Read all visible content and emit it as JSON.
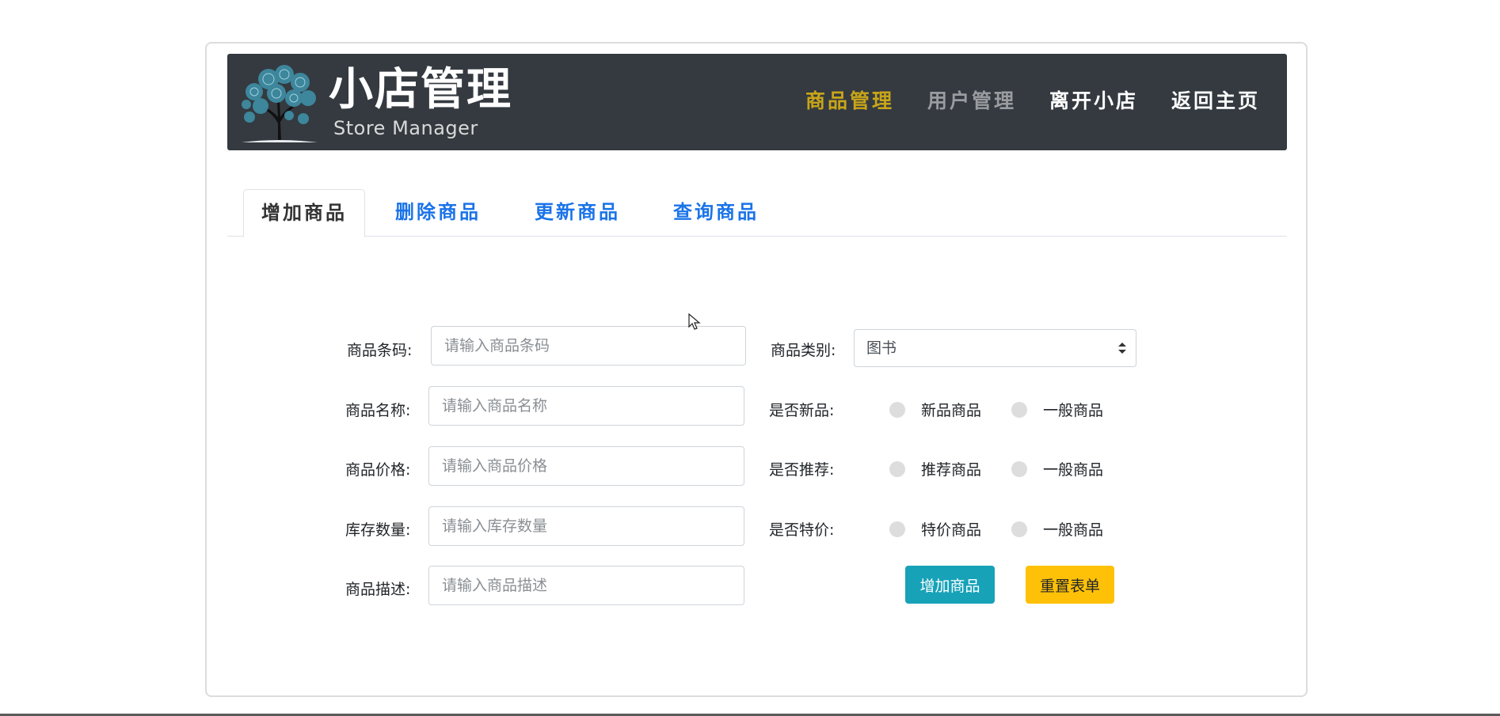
{
  "header": {
    "title": "小店管理",
    "subtitle": "Store Manager",
    "nav": [
      "商品管理",
      "用户管理",
      "离开小店",
      "返回主页"
    ]
  },
  "tabs": [
    "增加商品",
    "删除商品",
    "更新商品",
    "查询商品"
  ],
  "form": {
    "barcode": {
      "label": "商品条码:",
      "placeholder": "请输入商品条码"
    },
    "name": {
      "label": "商品名称:",
      "placeholder": "请输入商品名称"
    },
    "price": {
      "label": "商品价格:",
      "placeholder": "请输入商品价格"
    },
    "stock": {
      "label": "库存数量:",
      "placeholder": "请输入库存数量"
    },
    "desc": {
      "label": "商品描述:",
      "placeholder": "请输入商品描述"
    },
    "category": {
      "label": "商品类别:",
      "value": "图书"
    },
    "is_new": {
      "label": "是否新品:",
      "options": [
        "新品商品",
        "一般商品"
      ]
    },
    "is_recommended": {
      "label": "是否推荐:",
      "options": [
        "推荐商品",
        "一般商品"
      ]
    },
    "is_special": {
      "label": "是否特价:",
      "options": [
        "特价商品",
        "一般商品"
      ]
    },
    "add_button": "增加商品",
    "reset_button": "重置表单"
  },
  "colors": {
    "header_bg": "#343a40",
    "nav_active": "#c8a519",
    "tab_link": "#1a73e8",
    "add_button": "#17a2b8",
    "reset_button": "#ffc107"
  }
}
